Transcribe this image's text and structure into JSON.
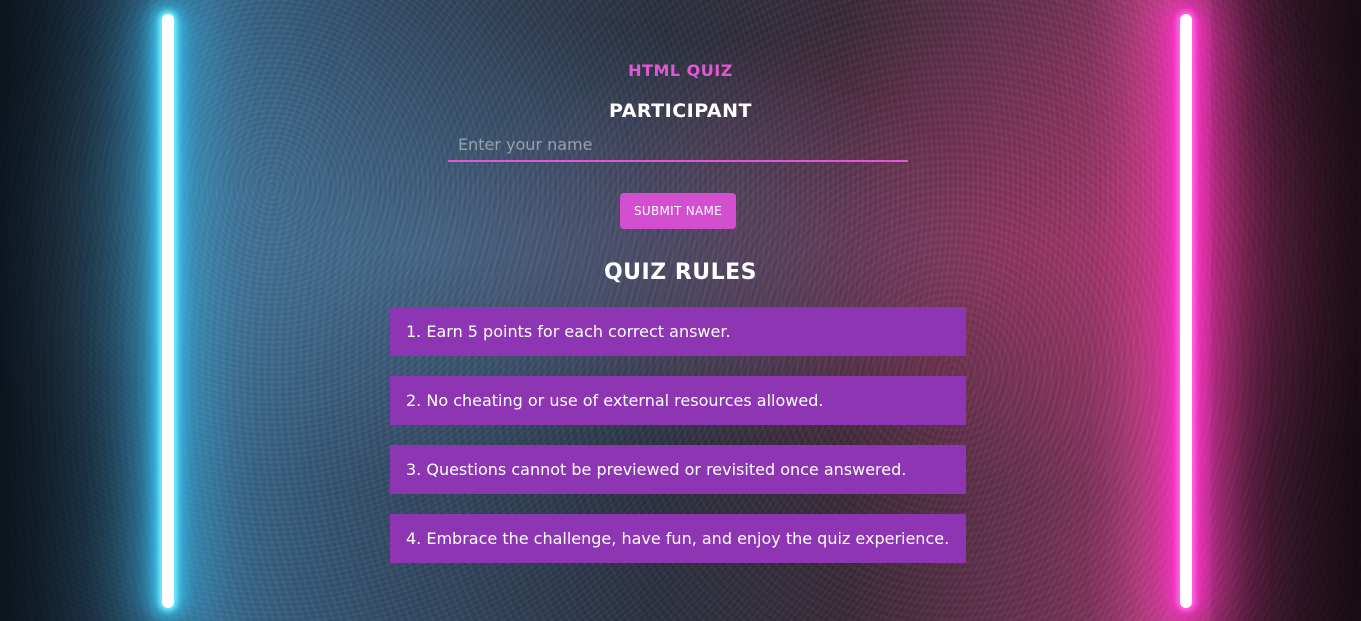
{
  "app": {
    "title": "HTML QUIZ"
  },
  "participant": {
    "heading": "PARTICIPANT",
    "name_input": {
      "value": "",
      "placeholder": "Enter your name"
    },
    "submit_label": "SUBMIT NAME"
  },
  "rules": {
    "heading": "QUIZ RULES",
    "items": [
      "1. Earn 5 points for each correct answer.",
      "2. No cheating or use of external resources allowed.",
      "3. Questions cannot be previewed or revisited once answered.",
      "4. Embrace the challenge, have fun, and enjoy the quiz experience."
    ]
  },
  "colors": {
    "accent": "#d44fcf",
    "title": "#e158d6",
    "rule_background": "#8e35b4",
    "neon_left": "#36c8f0",
    "neon_right": "#ff2fd0"
  }
}
